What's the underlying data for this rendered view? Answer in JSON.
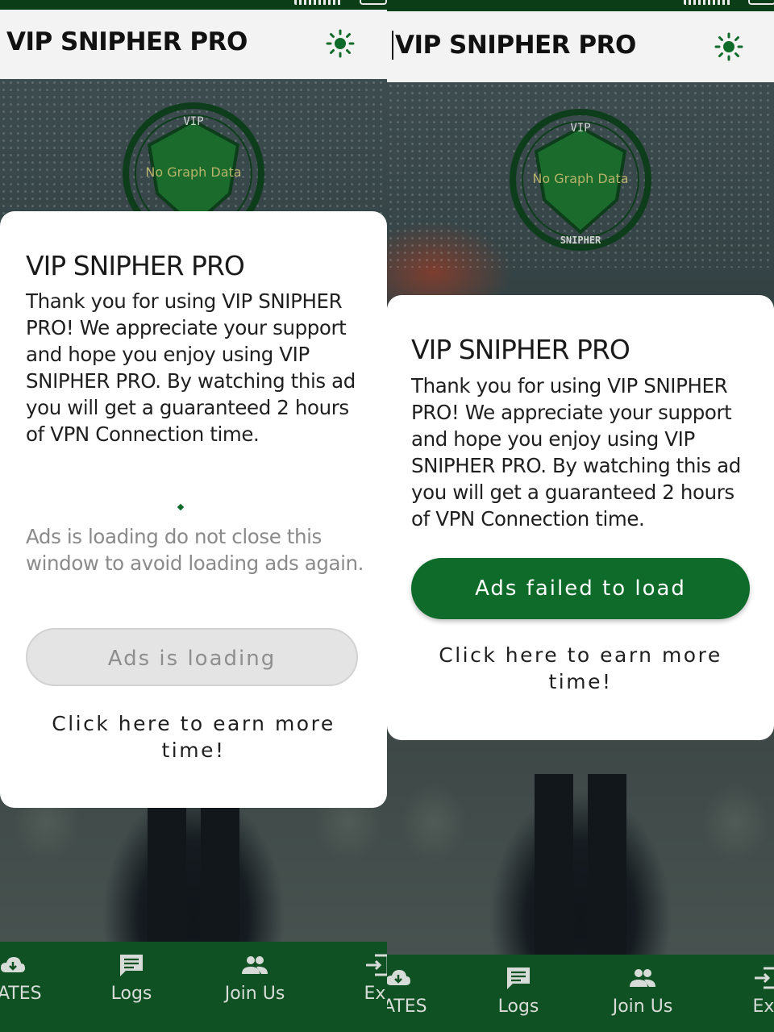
{
  "screens": [
    {
      "app_title": "VIP SNIPHER PRO",
      "logo_overlay_text": "No Graph Data",
      "dialog": {
        "title": "VIP SNIPHER PRO",
        "body": "Thank you for using VIP SNIPHER PRO! We appreciate your support and hope you enjoy using VIP SNIPHER PRO.  By watching this ad you will get a guaranteed 2 hours of VPN Connection time.",
        "loading_note": "Ads is loading do not close this window to avoid loading ads again.",
        "button_label": "Ads is loading",
        "button_state": "disabled",
        "earn_link": "Click here to earn more time!"
      },
      "nav": [
        {
          "label": "DATES",
          "icon": "cloud-download-icon"
        },
        {
          "label": "Logs",
          "icon": "chat-icon"
        },
        {
          "label": "Join Us",
          "icon": "group-icon"
        },
        {
          "label": "Exi",
          "icon": "exit-icon"
        }
      ]
    },
    {
      "app_title": "VIP SNIPHER PRO",
      "logo_overlay_text": "No Graph Data",
      "dialog": {
        "title": "VIP SNIPHER PRO",
        "body": "Thank you for using VIP SNIPHER PRO! We appreciate your support and hope you enjoy using VIP SNIPHER PRO.  By watching this ad you will get a guaranteed 2 hours of VPN Connection time.",
        "button_label": "Ads failed to load",
        "button_state": "enabled",
        "earn_link": "Click here to earn more time!"
      },
      "nav": [
        {
          "label": "DATES",
          "icon": "cloud-download-icon"
        },
        {
          "label": "Logs",
          "icon": "chat-icon"
        },
        {
          "label": "Join Us",
          "icon": "group-icon"
        },
        {
          "label": "Exi",
          "icon": "exit-icon"
        }
      ]
    }
  ],
  "colors": {
    "brand_green": "#0f6b2a",
    "nav_green": "#0f5122",
    "status_green": "#0b3d17",
    "dialog_bg": "#ffffff",
    "disabled_button": "#e4e4e4"
  },
  "logo_ring_text": "SNIPHER",
  "logo_badge_text": "VIP"
}
